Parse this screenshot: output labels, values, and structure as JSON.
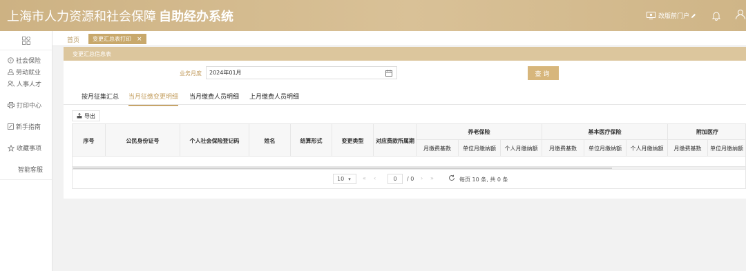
{
  "header": {
    "title_prefix": "上海市人力资源和社会保障",
    "title_bold": "自助经办系统",
    "portal_label": "改版前门户",
    "icons": [
      "monitor-icon",
      "pencil-icon",
      "bell-icon",
      "user-icon"
    ]
  },
  "sidebar": {
    "items": [
      {
        "label": "社会保险",
        "icon": "coin-icon"
      },
      {
        "label": "劳动就业",
        "icon": "person-icon"
      },
      {
        "label": "人事人才",
        "icon": "people-icon"
      },
      {
        "label": "打印中心",
        "icon": "printer-icon"
      },
      {
        "label": "新手指南",
        "icon": "guide-icon"
      },
      {
        "label": "收藏事项",
        "icon": "star-icon"
      },
      {
        "label": "智能客服",
        "icon": ""
      }
    ]
  },
  "tabs": {
    "home": "首页",
    "active": "变更汇总表打印",
    "close": "×"
  },
  "panel": {
    "title": "变更汇总信息表"
  },
  "form": {
    "period_label": "业务月度",
    "period_value": "2024年01月",
    "query_button": "查询"
  },
  "subtabs": [
    "按月征集汇总",
    "当月征缴变更明细",
    "当月缴费人员明细",
    "上月缴费人员明细"
  ],
  "active_subtab": 1,
  "export_label": "导出",
  "table": {
    "columns": [
      "序号",
      "公民身份证号",
      "个人社会保险登记码",
      "姓名",
      "结算形式",
      "变更类型",
      "对应费款所属期"
    ],
    "groups": [
      "养老保险",
      "基本医疗保险",
      "附加医疗"
    ],
    "subcolumns": [
      "月缴费基数",
      "单位月缴纳额",
      "个人月缴纳额",
      "月缴费基数",
      "单位月缴纳额",
      "个人月缴纳额",
      "月缴费基数",
      "单位月缴纳额"
    ]
  },
  "pagination": {
    "page_size": "10",
    "current_page": "0",
    "total_pages": "/ 0",
    "summary": "每页 10 条, 共 0 条"
  },
  "colors": {
    "header_gold": "#d2b88a",
    "accent": "#c8a86b",
    "button": "#d7b67c"
  }
}
